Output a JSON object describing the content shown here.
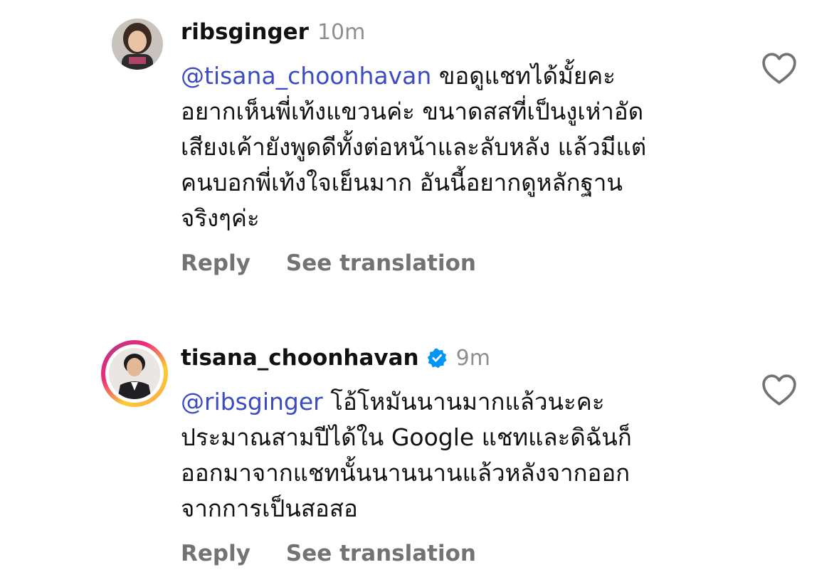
{
  "comments": [
    {
      "username": "ribsginger",
      "time": "10m",
      "verified": false,
      "mention": "@tisana_choonhavan",
      "lines": [
        " ขอดูแชทได้มั้ยคะ",
        "อยากเห็นพี่เท้งแขวนค่ะ ขนาดสสที่เป็นงูเห่าอัด",
        "เสียงเค้ายังพูดดีทั้งต่อหน้าและลับหลัง แล้วมีแต่",
        "คนบอกพี่เท้งใจเย็นมาก อันนี้อยากดูหลักฐาน",
        "จริงๆค่ะ"
      ],
      "reply_label": "Reply",
      "translate_label": "See translation",
      "avatar_icon": "user-photo-girl"
    },
    {
      "username": "tisana_choonhavan",
      "time": "9m",
      "verified": true,
      "mention": "@ribsginger",
      "lines": [
        " โอ้โหมันนานมากแล้วนะคะ",
        "ประมาณสามปีได้ใน Google แชทและดิฉันก็",
        "ออกมาจากแชทนั้นนานนานแล้วหลังจากออก",
        "จากการเป็นสอสอ"
      ],
      "reply_label": "Reply",
      "translate_label": "See translation",
      "avatar_icon": "user-photo-woman-story-ring"
    }
  ],
  "colors": {
    "mention": "#3b4cc0",
    "meta_gray": "#8e8e93",
    "action_gray": "#737373",
    "verified_blue": "#0095f6"
  },
  "icons": {
    "like": "heart-outline-icon",
    "verified": "verified-badge-icon"
  }
}
